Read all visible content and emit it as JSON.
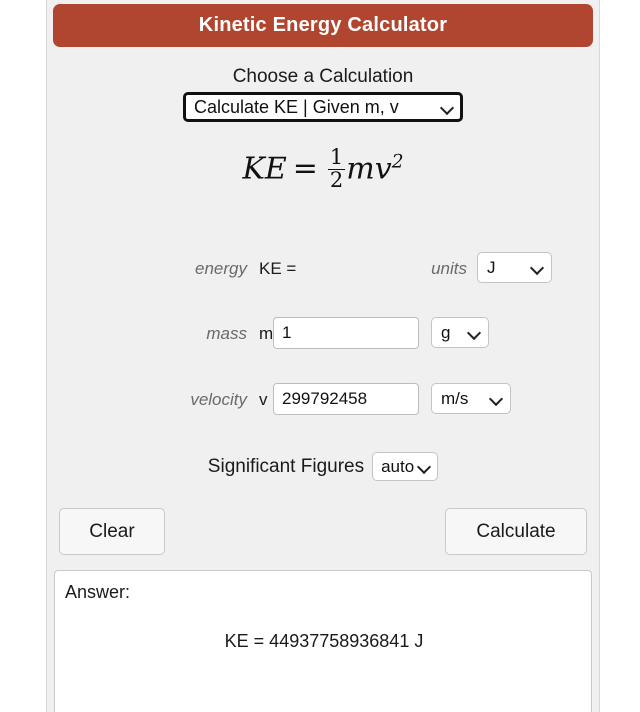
{
  "header": {
    "title": "Kinetic Energy Calculator",
    "accent_color": "#b0462f",
    "title_color": "#ffffff"
  },
  "panel": {
    "background_color": "#f0f0f0"
  },
  "calculation": {
    "choose_label": "Choose a Calculation",
    "selected_option": "Calculate KE | Given m, v",
    "chevron": "chevron-down-icon"
  },
  "formula": {
    "lhs": "KE",
    "equals": "=",
    "numerator": "1",
    "denominator": "2",
    "rhs_base": "mv",
    "rhs_exponent": "2",
    "plain": "KE = 1/2 mv^2"
  },
  "fields": {
    "energy": {
      "name_label": "energy",
      "var_label": "KE =",
      "value": "",
      "units_word": "units",
      "unit_value": "J"
    },
    "mass": {
      "name_label": "mass",
      "var_label": "m =",
      "value": "1",
      "unit_value": "g"
    },
    "velocity": {
      "name_label": "velocity",
      "var_label": "v =",
      "value": "299792458",
      "unit_value": "m/s"
    }
  },
  "sigfig": {
    "label": "Significant Figures",
    "value": "auto"
  },
  "buttons": {
    "clear": "Clear",
    "calculate": "Calculate"
  },
  "answer": {
    "label": "Answer:",
    "result": "KE = 44937758936841 J"
  }
}
